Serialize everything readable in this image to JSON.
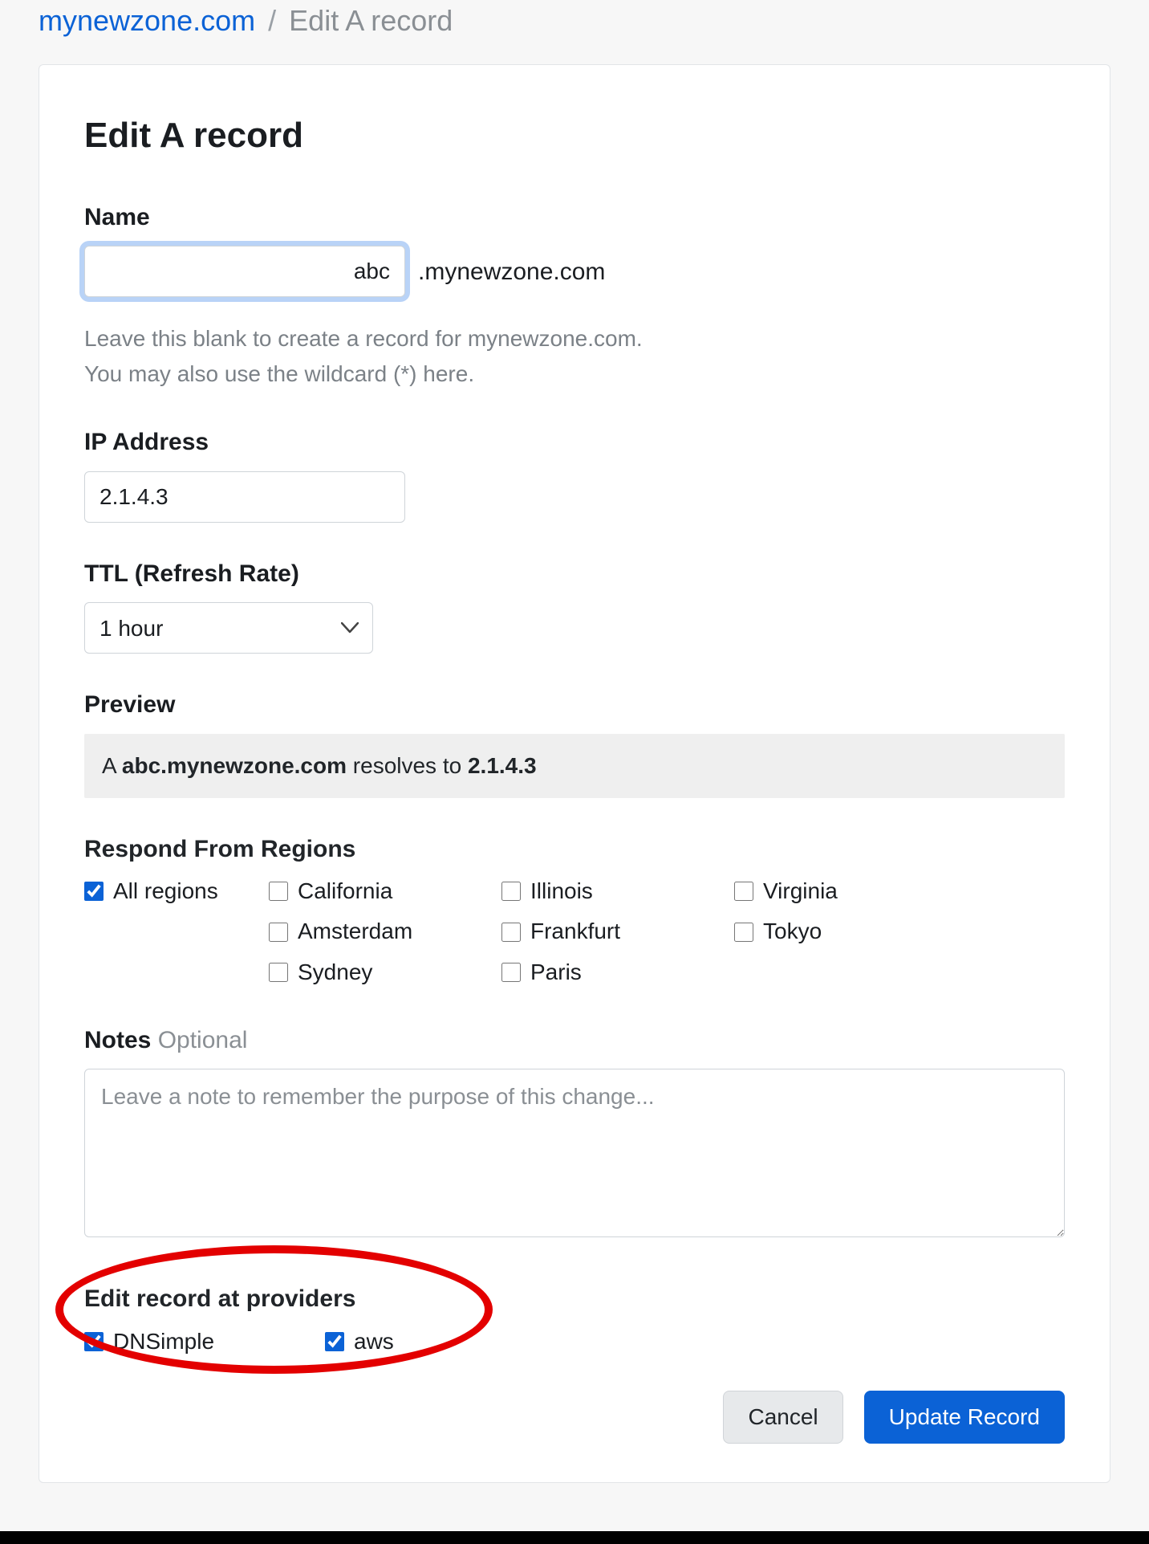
{
  "breadcrumb": {
    "domain": "mynewzone.com",
    "separator": "/",
    "page": "Edit A record"
  },
  "form": {
    "title": "Edit A record",
    "name": {
      "label": "Name",
      "value": "abc",
      "suffix": ".mynewzone.com",
      "hint_line1": "Leave this blank to create a record for mynewzone.com.",
      "hint_line2": "You may also use the wildcard (*) here."
    },
    "ip": {
      "label": "IP Address",
      "value": "2.1.4.3"
    },
    "ttl": {
      "label": "TTL (Refresh Rate)",
      "selected": "1 hour"
    },
    "preview": {
      "label": "Preview",
      "prefix": "A ",
      "host": "abc.mynewzone.com",
      "mid": " resolves to ",
      "target": "2.1.4.3"
    },
    "regions": {
      "label": "Respond From Regions",
      "items": [
        {
          "label": "All regions",
          "checked": true
        },
        {
          "label": "California",
          "checked": false
        },
        {
          "label": "Illinois",
          "checked": false
        },
        {
          "label": "Virginia",
          "checked": false
        },
        {
          "label": "Amsterdam",
          "checked": false
        },
        {
          "label": "Frankfurt",
          "checked": false
        },
        {
          "label": "Tokyo",
          "checked": false
        },
        {
          "label": "Sydney",
          "checked": false
        },
        {
          "label": "Paris",
          "checked": false
        }
      ]
    },
    "notes": {
      "label": "Notes",
      "optional": "Optional",
      "placeholder": "Leave a note to remember the purpose of this change...",
      "value": ""
    },
    "providers": {
      "label": "Edit record at providers",
      "items": [
        {
          "label": "DNSimple",
          "checked": true
        },
        {
          "label": "aws",
          "checked": true
        }
      ]
    },
    "actions": {
      "cancel": "Cancel",
      "submit": "Update Record"
    }
  }
}
